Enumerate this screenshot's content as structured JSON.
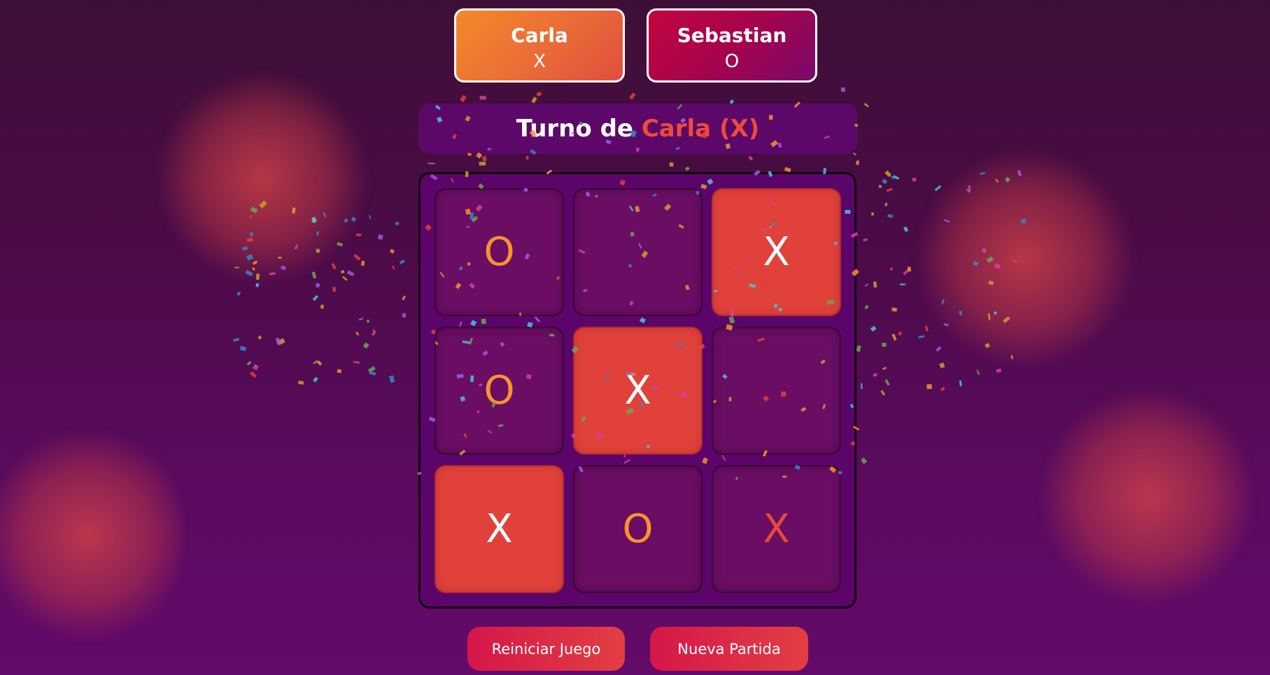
{
  "players": [
    {
      "name": "Carla",
      "mark": "X"
    },
    {
      "name": "Sebastian",
      "mark": "O"
    }
  ],
  "turn": {
    "prefix": "Turno de",
    "player": "Carla (X)"
  },
  "board": {
    "cells": [
      "O",
      "",
      "X",
      "O",
      "X",
      "",
      "X",
      "O",
      "X"
    ],
    "winning_cells": [
      2,
      4,
      6
    ]
  },
  "buttons": {
    "reset": "Reiniciar Juego",
    "new_game": "Nueva Partida"
  },
  "colors": {
    "accent_orange": "#f7932f",
    "accent_red": "#e0413b",
    "board_bg": "#5b056a",
    "cell_bg": "#6a0d63"
  }
}
